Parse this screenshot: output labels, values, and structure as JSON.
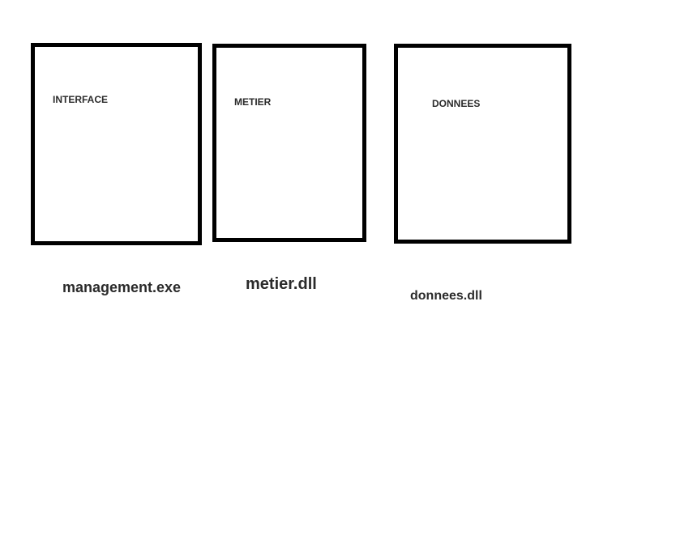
{
  "layers": [
    {
      "id": "interface",
      "label": "INTERFACE",
      "file": "management.exe"
    },
    {
      "id": "metier",
      "label": "METIER",
      "file": "metier.dll"
    },
    {
      "id": "donnees",
      "label": "DONNEES",
      "file": "donnees.dll"
    }
  ],
  "colors": {
    "border": "#000000",
    "text": "#2b2b2b",
    "background": "#ffffff"
  }
}
